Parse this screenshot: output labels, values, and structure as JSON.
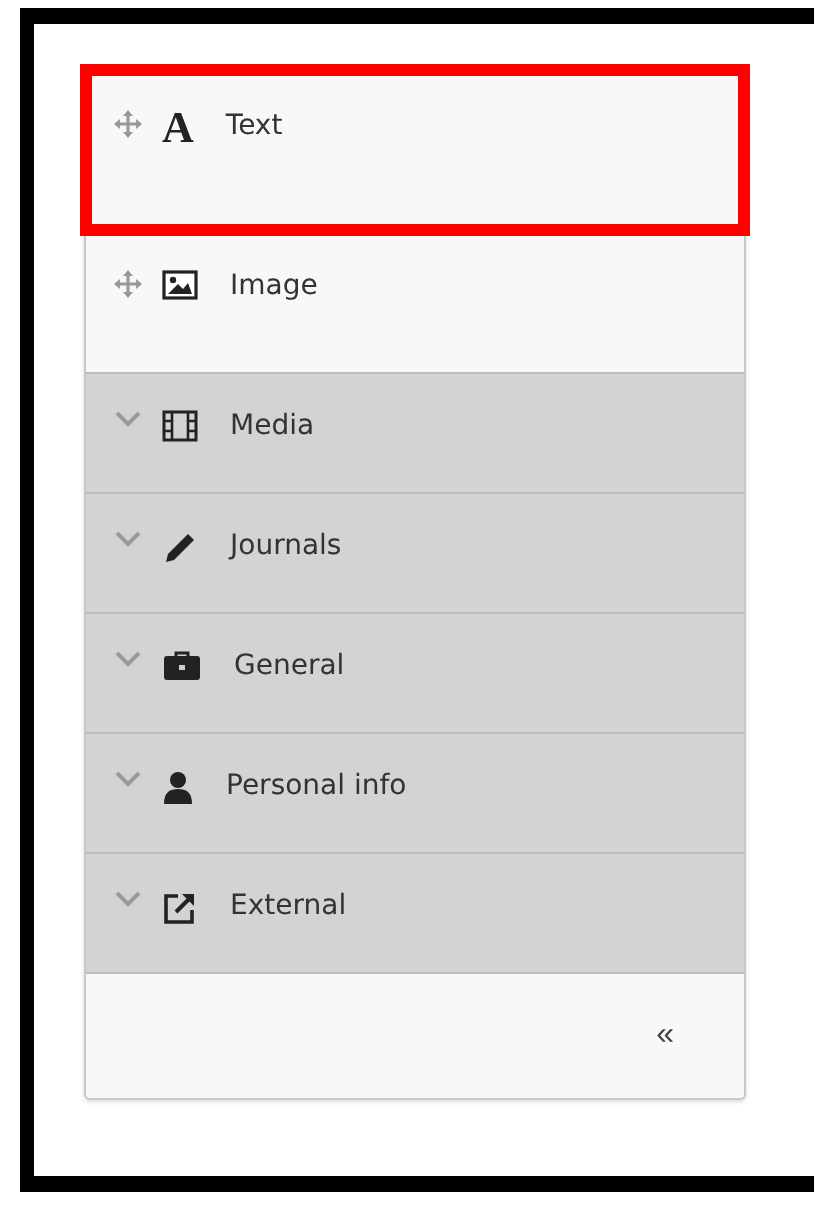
{
  "panel": {
    "items": [
      {
        "kind": "draggable",
        "glyph": "A",
        "label": "Text",
        "highlighted": true
      },
      {
        "kind": "draggable",
        "label": "Image",
        "highlighted": false
      },
      {
        "kind": "group",
        "label": "Media"
      },
      {
        "kind": "group",
        "label": "Journals"
      },
      {
        "kind": "group",
        "label": "General"
      },
      {
        "kind": "group",
        "label": "Personal info"
      },
      {
        "kind": "group",
        "label": "External"
      }
    ],
    "collapse": "«"
  }
}
